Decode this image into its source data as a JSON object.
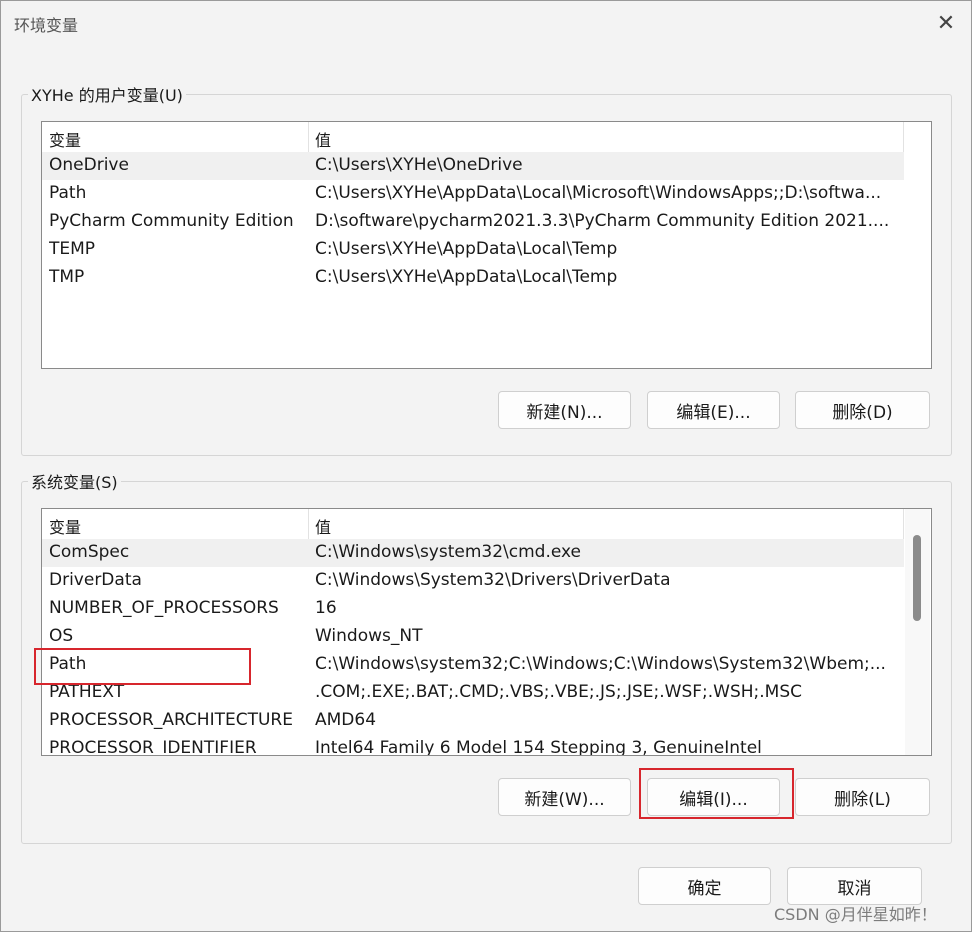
{
  "window": {
    "title": "环境变量",
    "close_glyph": "✕"
  },
  "user_vars": {
    "group_label": "XYHe 的用户变量(U)",
    "col_var": "变量",
    "col_val": "值",
    "rows": [
      {
        "name": "OneDrive",
        "value": "C:\\Users\\XYHe\\OneDrive"
      },
      {
        "name": "Path",
        "value": "C:\\Users\\XYHe\\AppData\\Local\\Microsoft\\WindowsApps;;D:\\softwa..."
      },
      {
        "name": "PyCharm Community Edition",
        "value": "D:\\software\\pycharm2021.3.3\\PyCharm Community Edition 2021...."
      },
      {
        "name": "TEMP",
        "value": "C:\\Users\\XYHe\\AppData\\Local\\Temp"
      },
      {
        "name": "TMP",
        "value": "C:\\Users\\XYHe\\AppData\\Local\\Temp"
      }
    ],
    "new_label": "新建(N)...",
    "edit_label": "编辑(E)...",
    "delete_label": "删除(D)"
  },
  "sys_vars": {
    "group_label": "系统变量(S)",
    "col_var": "变量",
    "col_val": "值",
    "rows": [
      {
        "name": "ComSpec",
        "value": "C:\\Windows\\system32\\cmd.exe"
      },
      {
        "name": "DriverData",
        "value": "C:\\Windows\\System32\\Drivers\\DriverData"
      },
      {
        "name": "NUMBER_OF_PROCESSORS",
        "value": "16"
      },
      {
        "name": "OS",
        "value": "Windows_NT"
      },
      {
        "name": "Path",
        "value": "C:\\Windows\\system32;C:\\Windows;C:\\Windows\\System32\\Wbem;..."
      },
      {
        "name": "PATHEXT",
        "value": ".COM;.EXE;.BAT;.CMD;.VBS;.VBE;.JS;.JSE;.WSF;.WSH;.MSC"
      },
      {
        "name": "PROCESSOR_ARCHITECTURE",
        "value": "AMD64"
      },
      {
        "name": "PROCESSOR_IDENTIFIER",
        "value": "Intel64 Family 6 Model 154 Stepping 3, GenuineIntel"
      }
    ],
    "new_label": "新建(W)...",
    "edit_label": "编辑(I)...",
    "delete_label": "删除(L)"
  },
  "footer": {
    "ok_label": "确定",
    "cancel_label": "取消"
  },
  "watermark": "CSDN @月伴星如昨！",
  "colors": {
    "highlight": "#d7262d",
    "selection": "#f0f0f0"
  }
}
